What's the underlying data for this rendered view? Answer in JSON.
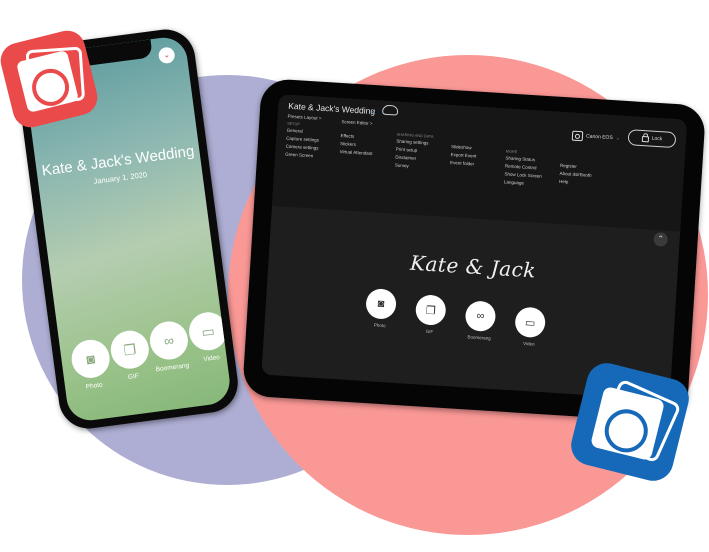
{
  "background": {
    "purple_circle": "#aeaed4",
    "pink_circle": "#fa9896"
  },
  "app_icons": [
    {
      "name": "red-camera-app",
      "color": "#ea4a4a"
    },
    {
      "name": "blue-camera-app",
      "color": "#1669b8"
    }
  ],
  "phone": {
    "menu_button_icon": "chevron-down",
    "title": "Kate & Jack's Wedding",
    "date": "January 1, 2020",
    "actions": [
      {
        "label": "Photo",
        "icon": "photo"
      },
      {
        "label": "GIF",
        "icon": "gif"
      },
      {
        "label": "Boomerang",
        "icon": "∞"
      },
      {
        "label": "Video",
        "icon": "video"
      }
    ]
  },
  "tablet": {
    "event_title": "Kate & Jack's Wedding",
    "columns": [
      {
        "items": [
          "Presets Layout >",
          "SETUP",
          "General",
          "Capture settings",
          "Camera settings",
          "Green Screen"
        ]
      },
      {
        "items": [
          "Screen Editor >",
          "Effects",
          "Stickers",
          "Virtual Attendant"
        ]
      },
      {
        "items": [
          "SHARING AND DATA",
          "Sharing settings",
          "Print setup",
          "Disclaimer",
          "Survey"
        ]
      },
      {
        "items": [
          "Slideshow",
          "Export Event",
          "Event folder"
        ]
      },
      {
        "items": [
          "MORE",
          "Sharing Status",
          "Remote Control",
          "Show Lock Screen",
          "Language"
        ]
      },
      {
        "items": [
          "Register",
          "About dslrBooth",
          "Help"
        ]
      }
    ],
    "camera": "Canon EOS",
    "lock_label": "Lock",
    "collapse_icon": "chevron-up",
    "script_title": "Kate & Jack",
    "actions": [
      {
        "label": "Photo",
        "icon": "photo"
      },
      {
        "label": "GIF",
        "icon": "gif"
      },
      {
        "label": "Boomerang",
        "icon": "∞"
      },
      {
        "label": "Video",
        "icon": "video"
      }
    ]
  }
}
